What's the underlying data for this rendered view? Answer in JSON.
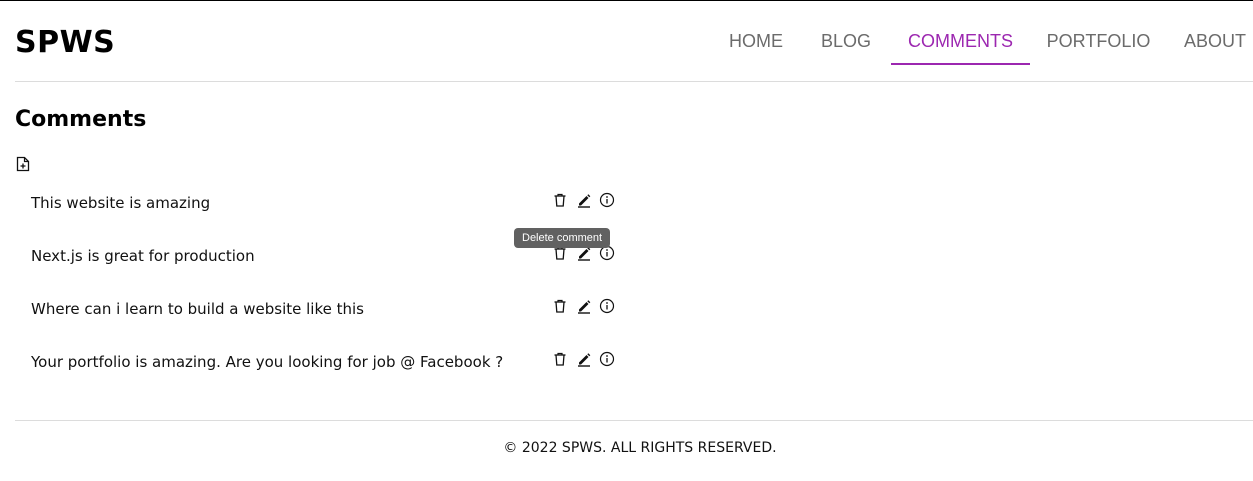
{
  "header": {
    "logo": "SPWS",
    "nav": [
      {
        "label": "HOME",
        "active": false
      },
      {
        "label": "BLOG",
        "active": false
      },
      {
        "label": "COMMENTS",
        "active": true
      },
      {
        "label": "PORTFOLIO",
        "active": false
      },
      {
        "label": "ABOUT",
        "active": false
      }
    ]
  },
  "main": {
    "title": "Comments",
    "add_icon": "add-document-icon",
    "comments": [
      {
        "text": "This website is amazing"
      },
      {
        "text": "Next.js is great for production"
      },
      {
        "text": "Where can i learn to build a website like this"
      },
      {
        "text": "Your portfolio is amazing. Are you looking for job @ Facebook ?"
      }
    ],
    "actions": [
      "delete-icon",
      "edit-icon",
      "info-icon"
    ],
    "tooltip": "Delete comment"
  },
  "footer": {
    "text": "© 2022 SPWS. ALL RIGHTS RESERVED."
  },
  "colors": {
    "accent": "#9c27b0",
    "nav_text": "#6b6b6b",
    "tooltip_bg": "#616161",
    "divider": "#dcdcdc"
  }
}
